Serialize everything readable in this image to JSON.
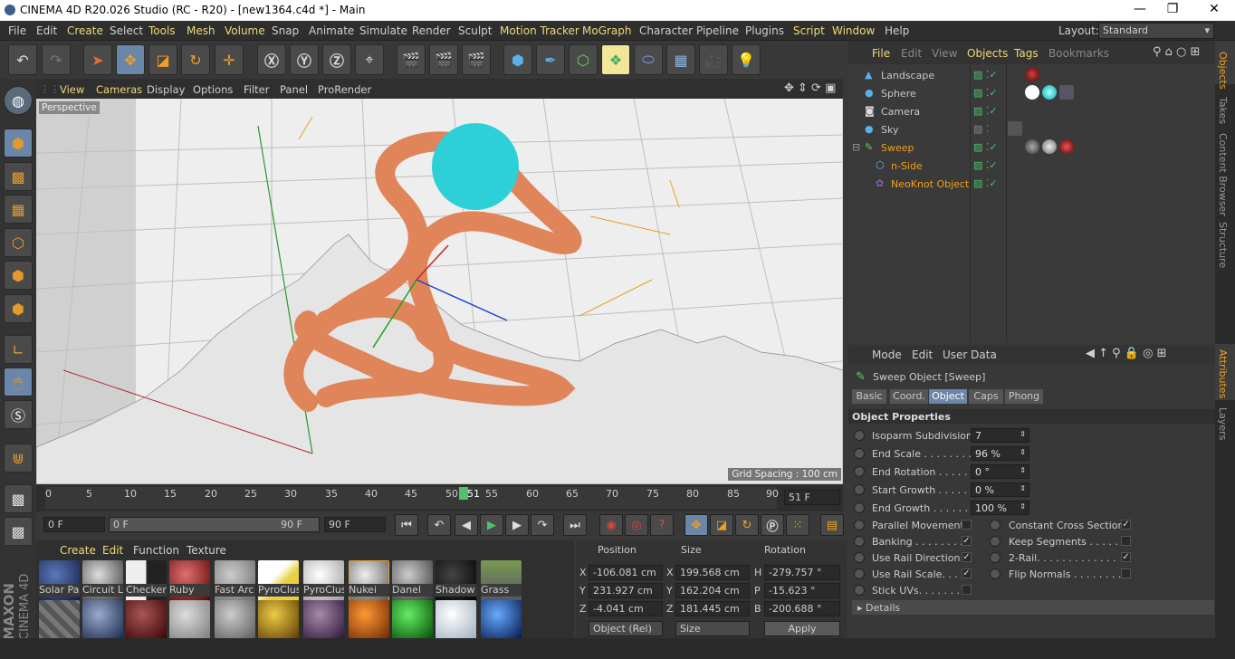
{
  "title": "CINEMA 4D R20.026 Studio (RC - R20) - [new1364.c4d *] - Main",
  "menu": [
    "File",
    "Edit",
    "Create",
    "Select",
    "Tools",
    "Mesh",
    "Volume",
    "Snap",
    "Animate",
    "Simulate",
    "Render",
    "Sculpt",
    "Motion Tracker",
    "MoGraph",
    "Character",
    "Pipeline",
    "Plugins",
    "Script",
    "Window",
    "Help"
  ],
  "layout_label": "Layout:",
  "layout_value": "Standard",
  "viewport": {
    "menu": [
      "View",
      "Cameras",
      "Display",
      "Options",
      "Filter",
      "Panel",
      "ProRender"
    ],
    "label": "Perspective",
    "grid_spacing": "Grid Spacing : 100 cm"
  },
  "timeline": {
    "ticks": [
      "0",
      "5",
      "10",
      "15",
      "20",
      "25",
      "30",
      "35",
      "40",
      "45",
      "50",
      "55",
      "60",
      "65",
      "70",
      "75",
      "80",
      "85",
      "90"
    ],
    "current": "51",
    "end_field": "51 F"
  },
  "transport": {
    "start": "0 F",
    "range_start": "0 F",
    "range_end": "90 F",
    "end": "90 F"
  },
  "materials": {
    "menu": [
      "Create",
      "Edit",
      "Function",
      "Texture"
    ],
    "row1": [
      "Solar Pa",
      "Circuit L",
      "Checker",
      "Ruby",
      "Fast Arc",
      "PyroClus",
      "PyroClus",
      "Nukei",
      "Danel",
      "Shadow",
      "Grass"
    ]
  },
  "coords": {
    "headers": [
      "Position",
      "Size",
      "Rotation"
    ],
    "rows": [
      {
        "a": "X",
        "pos": "-106.081 cm",
        "b": "X",
        "size": "199.568 cm",
        "c": "H",
        "rot": "-279.757 °"
      },
      {
        "a": "Y",
        "pos": "231.927 cm",
        "b": "Y",
        "size": "162.204 cm",
        "c": "P",
        "rot": "-15.623 °"
      },
      {
        "a": "Z",
        "pos": "-4.041 cm",
        "b": "Z",
        "size": "181.445 cm",
        "c": "B",
        "rot": "-200.688 °"
      }
    ],
    "mode": "Object (Rel)",
    "size_mode": "Size",
    "apply": "Apply"
  },
  "objects": {
    "menu": [
      "File",
      "Edit",
      "View",
      "Objects",
      "Tags",
      "Bookmarks"
    ],
    "items": [
      "Landscape",
      "Sphere",
      "Camera",
      "Sky",
      "Sweep",
      "n-Side",
      "NeoKnot Object"
    ]
  },
  "side_tabs": [
    "Objects",
    "Takes",
    "Content Browser",
    "Structure",
    "Attributes",
    "Layers"
  ],
  "attributes": {
    "menu": [
      "Mode",
      "Edit",
      "User Data"
    ],
    "title": "Sweep Object [Sweep]",
    "tabs": [
      "Basic",
      "Coord.",
      "Object",
      "Caps",
      "Phong"
    ],
    "section": "Object Properties",
    "fields": [
      {
        "label": "Isoparm Subdivision",
        "value": "7"
      },
      {
        "label": "End Scale . . . . . . . . .",
        "value": "96 %"
      },
      {
        "label": "End Rotation . . . . . .",
        "value": "0 °"
      },
      {
        "label": "Start Growth . . . . . .",
        "value": "0 %"
      },
      {
        "label": "End Growth . . . . . . .",
        "value": "100 %"
      }
    ],
    "checks_left": [
      {
        "label": "Parallel Movement",
        "on": false
      },
      {
        "label": "Banking . . . . . . . .",
        "on": true
      },
      {
        "label": "Use Rail Direction",
        "on": true
      },
      {
        "label": "Use Rail Scale. . . .",
        "on": true
      },
      {
        "label": "Stick UVs. . . . . . . .",
        "on": false
      }
    ],
    "checks_right": [
      {
        "label": "Constant Cross Section",
        "on": true
      },
      {
        "label": "Keep Segments . . . . . .",
        "on": false
      },
      {
        "label": "2-Rail. . . . . . . . . . . . .",
        "on": true
      },
      {
        "label": "Flip Normals . . . . . . . . .",
        "on": false
      }
    ],
    "details": "Details"
  },
  "brand": {
    "maxon": "MAXON",
    "c4d": "CINEMA 4D"
  }
}
